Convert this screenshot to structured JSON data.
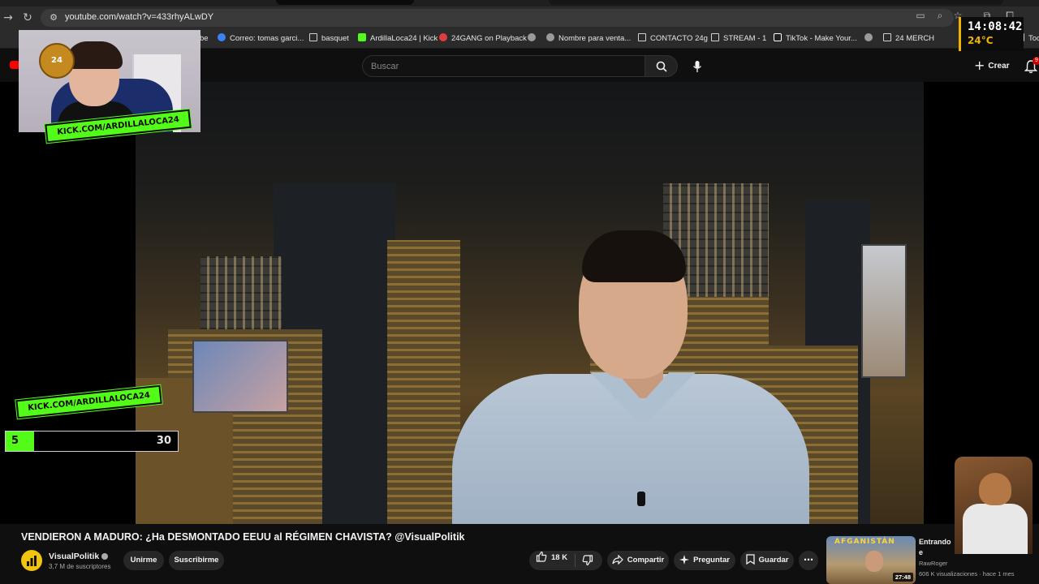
{
  "browser": {
    "url": "youtube.com/watch?v=433rhyALwDY",
    "bookmarks": [
      {
        "label": "be",
        "icon": "none"
      },
      {
        "label": "Correo: tomas garci...",
        "icon": "mail"
      },
      {
        "label": "basquet",
        "icon": "folder"
      },
      {
        "label": "ArdillaLoca24 | Kick",
        "icon": "kick"
      },
      {
        "label": "24GANG on Playback",
        "icon": "gang"
      },
      {
        "label": "",
        "icon": "circle"
      },
      {
        "label": "Nombre para venta...",
        "icon": "circle"
      },
      {
        "label": "CONTACTO 24g",
        "icon": "folder"
      },
      {
        "label": "STREAM - 1",
        "icon": "folder"
      },
      {
        "label": "TikTok - Make Your...",
        "icon": "tiktok"
      },
      {
        "label": "",
        "icon": "circle"
      },
      {
        "label": "24 MERCH",
        "icon": "folder"
      },
      {
        "label": "Toc",
        "icon": "folder"
      }
    ]
  },
  "youtube": {
    "search_placeholder": "Buscar",
    "create_label": "Crear",
    "notifications_count": "9"
  },
  "overlay": {
    "kick_top": "KICK.COM/ARDILLALOCA24",
    "kick_bottom": "KICK.COM/ARDILLALOCA24",
    "counter_value": "5",
    "counter_max": "30",
    "counter_fraction": 0.1667,
    "clock_time": "14:08:42",
    "clock_temp": "24°C",
    "logo_text": "24"
  },
  "video": {
    "title": "VENDIERON A MADURO: ¿Ha DESMONTADO EEUU al RÉGIMEN CHAVISTA? @VisualPolitik",
    "channel": "VisualPolitik",
    "subscribers": "3,7 M de suscriptores",
    "join_label": "Unirme",
    "subscribe_label": "Suscribirme",
    "likes": "18 K",
    "share_label": "Compartir",
    "ask_label": "Preguntar",
    "save_label": "Guardar"
  },
  "recommendation": {
    "thumb_text": "AFGANISTÁN",
    "duration": "27:48",
    "title": "Entrando e Controlad",
    "channel": "RawRoger",
    "meta": "606 K visualizaciones · hace 1 mes"
  },
  "colors": {
    "kick_green": "#53fc18",
    "youtube_red": "#ff0000",
    "clock_accent": "#f0b400"
  }
}
